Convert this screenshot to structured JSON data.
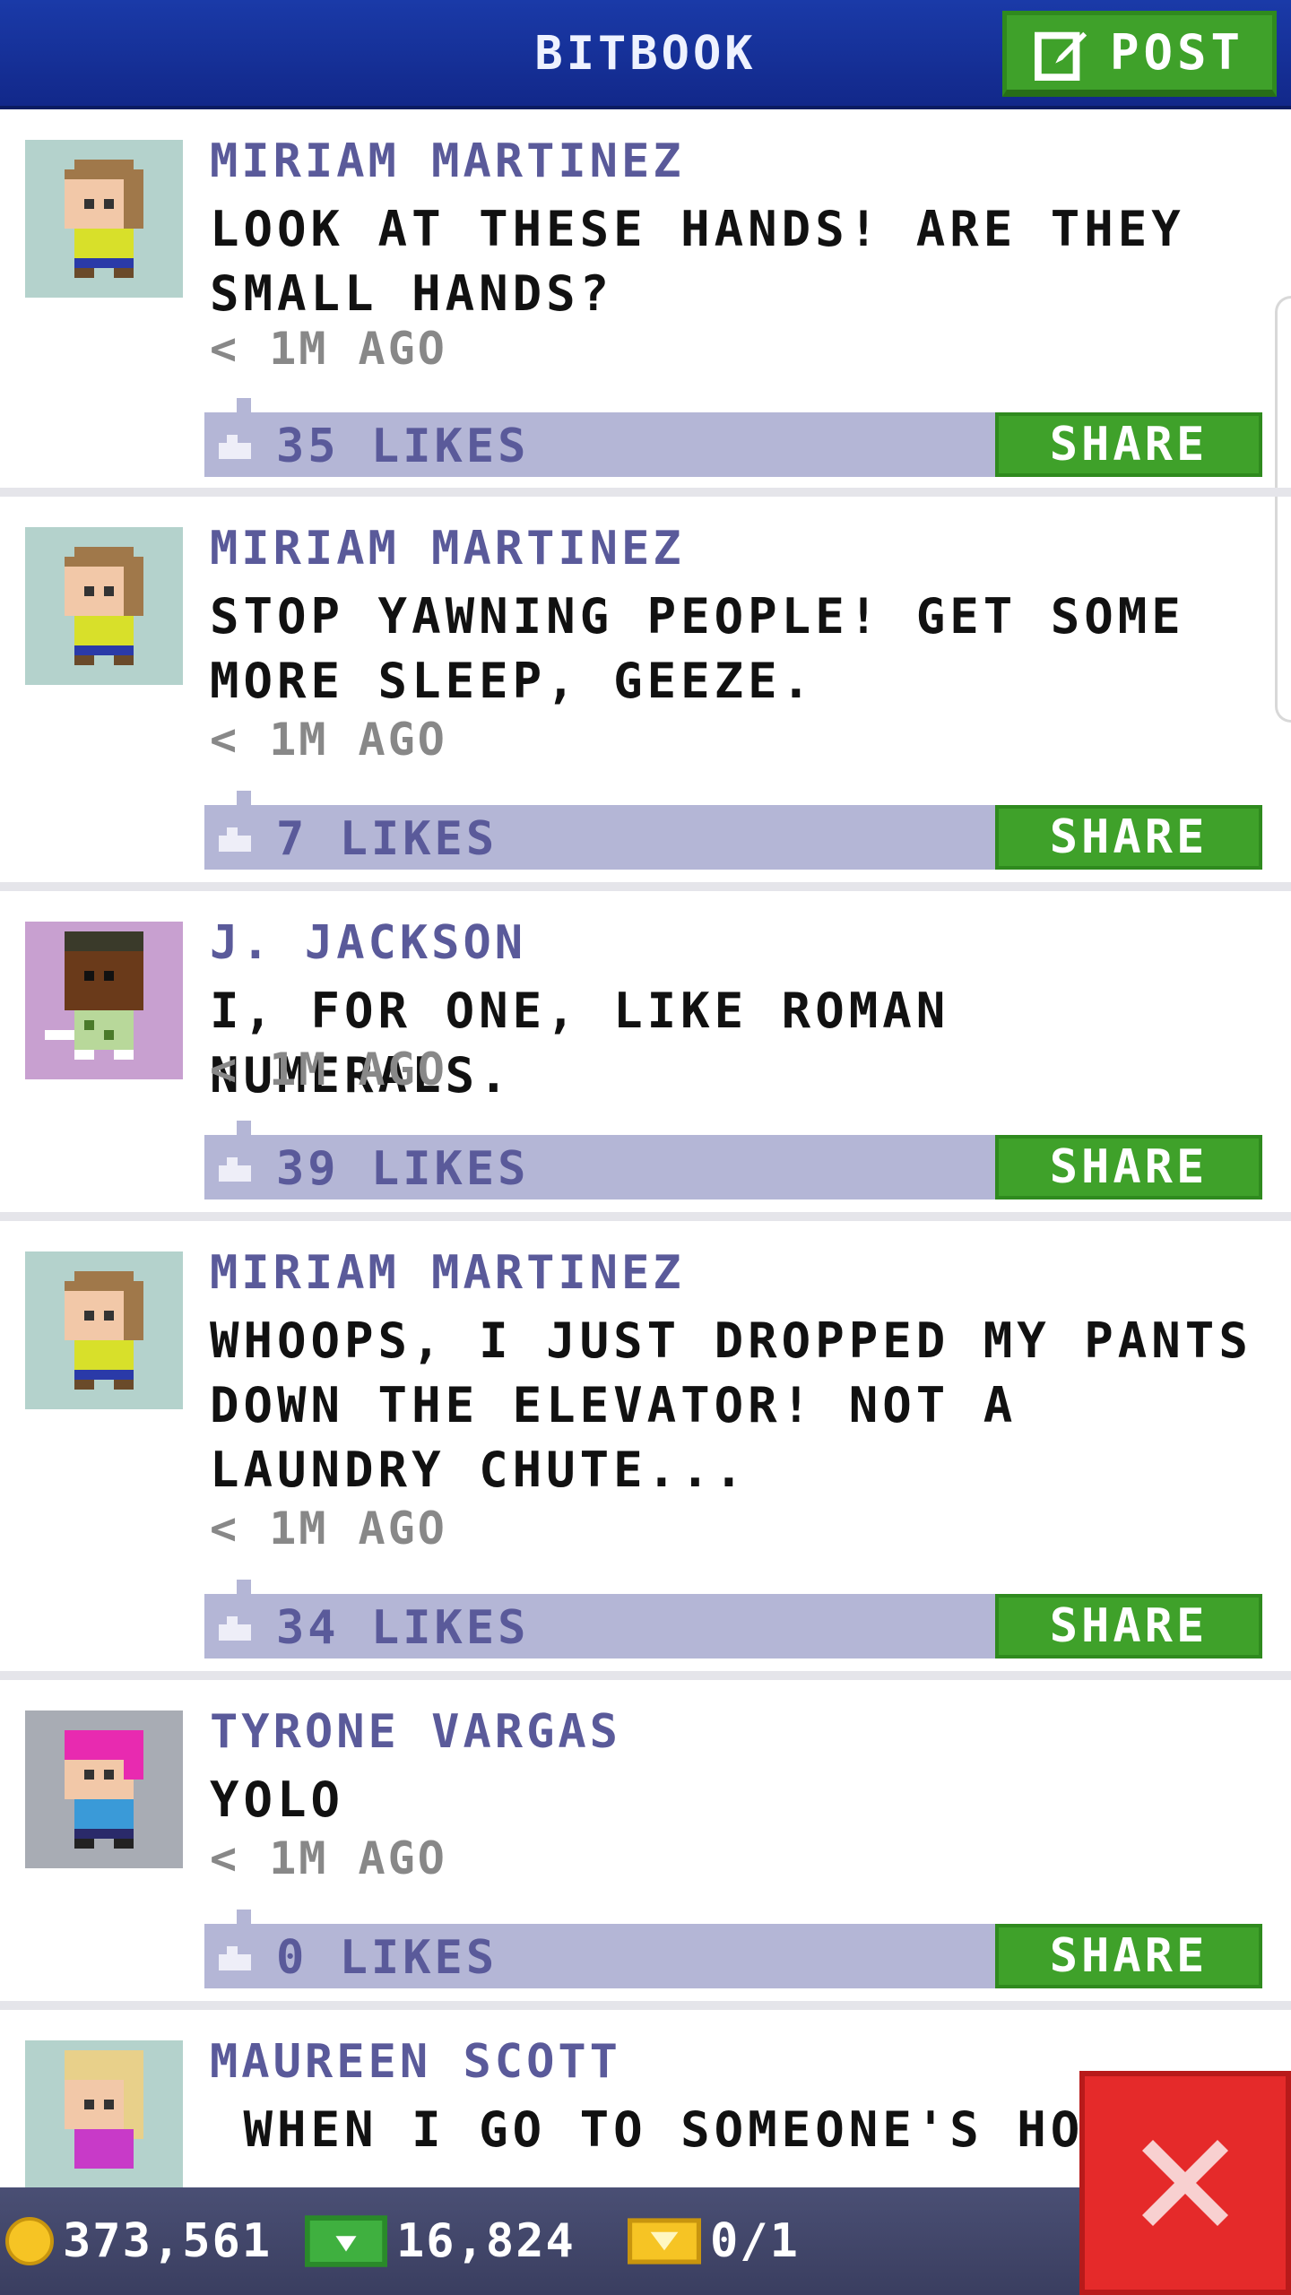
{
  "header": {
    "title": "BITBOOK",
    "post_label": "POST"
  },
  "posts": [
    {
      "author": "MIRIAM MARTINEZ",
      "text": "LOOK AT THESE HANDS! ARE THEY SMALL HANDS?",
      "time": "< 1M AGO",
      "likes": "35 LIKES",
      "share": "SHARE"
    },
    {
      "author": "MIRIAM MARTINEZ",
      "text": "STOP YAWNING PEOPLE! GET SOME MORE SLEEP, GEEZE.",
      "time": "< 1M AGO",
      "likes": "7 LIKES",
      "share": "SHARE"
    },
    {
      "author": "J. JACKSON",
      "text": "I, FOR ONE, LIKE ROMAN NUMERALS.",
      "time": "< 1M AGO",
      "likes": "39 LIKES",
      "share": "SHARE"
    },
    {
      "author": "MIRIAM MARTINEZ",
      "text": "WHOOPS, I JUST DROPPED MY PANTS DOWN THE ELEVATOR! NOT A LAUNDRY CHUTE...",
      "time": "< 1M AGO",
      "likes": "34 LIKES",
      "share": "SHARE"
    },
    {
      "author": "TYRONE VARGAS",
      "text": "YOLO",
      "time": "< 1M AGO",
      "likes": "0 LIKES",
      "share": "SHARE"
    },
    {
      "author": "MAUREEN SCOTT",
      "text": " WHEN I GO TO SOMEONE'S HOUS"
    }
  ],
  "bottom_bar": {
    "coins": "373,561",
    "bux": "16,824",
    "tickets": "0/1"
  },
  "colors": {
    "header": "#1a3aa8",
    "green": "#3fa12a",
    "like_bar": "#b4b6d6",
    "name": "#5a5a9a",
    "close": "#e52a2a"
  }
}
